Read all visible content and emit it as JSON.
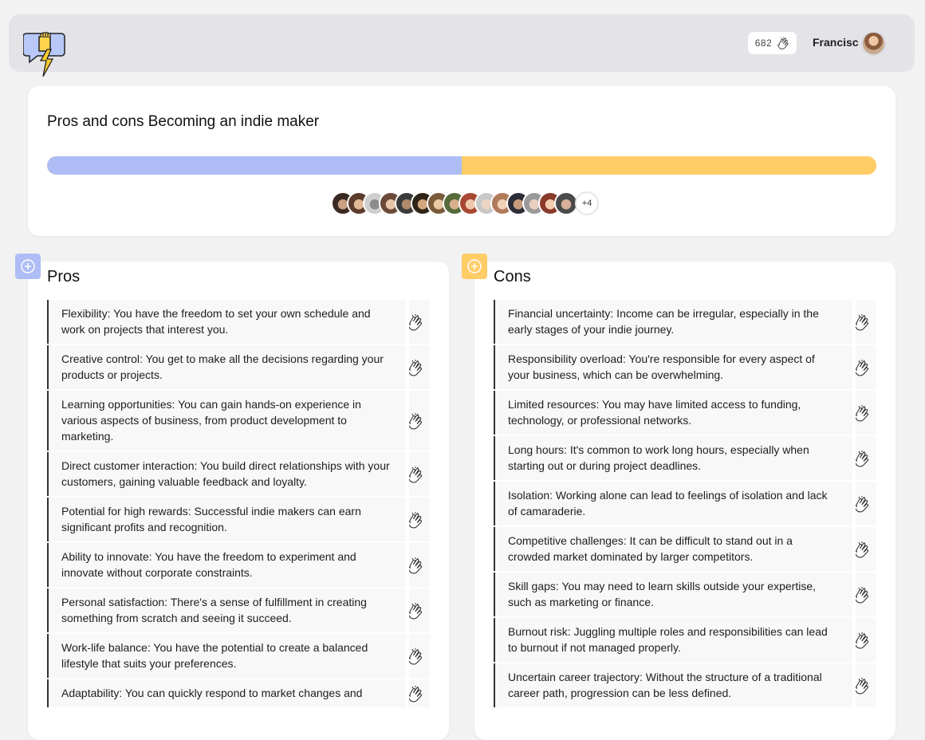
{
  "header": {
    "clap_count": "682",
    "username": "Francisc"
  },
  "summary": {
    "title": "Pros and cons Becoming an indie maker",
    "pros_fraction": 0.5,
    "participants_more": "+4",
    "participants_shown": 15
  },
  "colors": {
    "pros_accent": "#aebdf5",
    "cons_accent": "#ffcc66"
  },
  "pros": {
    "title": "Pros",
    "items": [
      "Flexibility: You have the freedom to set your own schedule and work on projects that interest you.",
      "Creative control: You get to make all the decisions regarding your products or projects.",
      "Learning opportunities: You can gain hands-on experience in various aspects of business, from product development to marketing.",
      "Direct customer interaction: You build direct relationships with your customers, gaining valuable feedback and loyalty.",
      "Potential for high rewards: Successful indie makers can earn significant profits and recognition.",
      "Ability to innovate: You have the freedom to experiment and innovate without corporate constraints.",
      "Personal satisfaction: There's a sense of fulfillment in creating something from scratch and seeing it succeed.",
      "Work-life balance: You have the potential to create a balanced lifestyle that suits your preferences.",
      "Adaptability: You can quickly respond to market changes and"
    ]
  },
  "cons": {
    "title": "Cons",
    "items": [
      "Financial uncertainty: Income can be irregular, especially in the early stages of your indie journey.",
      "Responsibility overload: You're responsible for every aspect of your business, which can be overwhelming.",
      "Limited resources: You may have limited access to funding, technology, or professional networks.",
      "Long hours: It's common to work long hours, especially when starting out or during project deadlines.",
      "Isolation: Working alone can lead to feelings of isolation and lack of camaraderie.",
      "Competitive challenges: It can be difficult to stand out in a crowded market dominated by larger competitors.",
      "Skill gaps: You may need to learn skills outside your expertise, such as marketing or finance.",
      "Burnout risk: Juggling multiple roles and responsibilities can lead to burnout if not managed properly.",
      "Uncertain career trajectory: Without the structure of a traditional career path, progression can be less defined."
    ]
  }
}
